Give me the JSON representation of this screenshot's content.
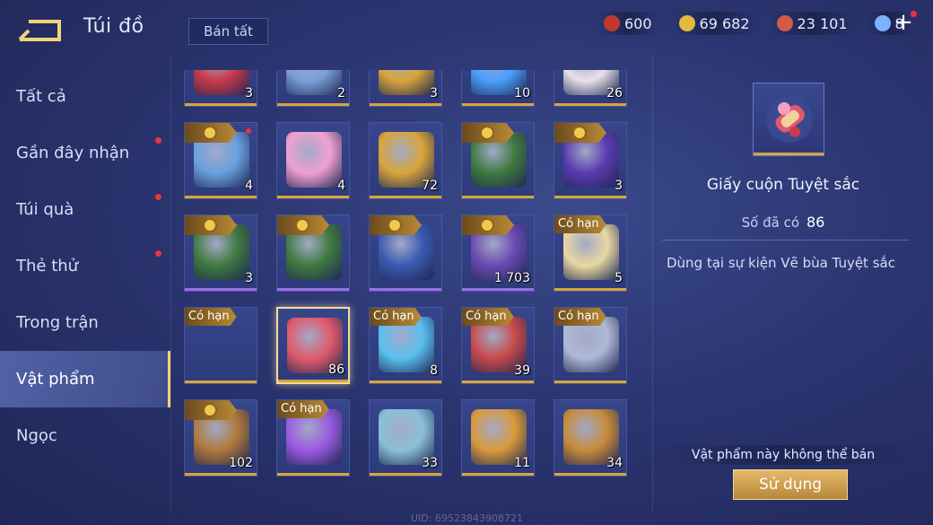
{
  "header": {
    "title": "Túi đồ",
    "sell_all": "Bán tất"
  },
  "currencies": [
    {
      "name": "red-gem-icon",
      "value": "600",
      "color": "#c0392b"
    },
    {
      "name": "gold-coin-icon",
      "value": "69 682",
      "color": "#e5b93b"
    },
    {
      "name": "ruby-icon",
      "value": "23 101",
      "color": "#d35a4a"
    },
    {
      "name": "crystal-card-icon",
      "value": "8",
      "color": "#7ab2ff"
    }
  ],
  "sidebar": {
    "items": [
      {
        "label": "Tất cả",
        "dot": false,
        "active": false
      },
      {
        "label": "Gần đây nhận",
        "dot": true,
        "active": false
      },
      {
        "label": "Túi quà",
        "dot": true,
        "active": false
      },
      {
        "label": "Thẻ thử",
        "dot": true,
        "active": false
      },
      {
        "label": "Trong trận",
        "dot": false,
        "active": false
      },
      {
        "label": "Vật phẩm",
        "dot": false,
        "active": true
      },
      {
        "label": "Ngọc",
        "dot": false,
        "active": false
      }
    ]
  },
  "inventory": {
    "items": [
      {
        "icon": "flower-bouquet-icon",
        "qty": "3",
        "bar": "gold",
        "tag": "",
        "coin": false,
        "dot": false,
        "color": "#c83a4a"
      },
      {
        "icon": "hero-portrait-icon",
        "qty": "2",
        "bar": "gold",
        "tag": "",
        "coin": false,
        "dot": false,
        "color": "#7aa0d8"
      },
      {
        "icon": "gold-shard-icon",
        "qty": "3",
        "bar": "gold",
        "tag": "",
        "coin": false,
        "dot": false,
        "color": "#d9a53a"
      },
      {
        "icon": "blue-crystal-icon",
        "qty": "10",
        "bar": "gold",
        "tag": "",
        "coin": false,
        "dot": false,
        "color": "#4aa0ff"
      },
      {
        "icon": "mask-icon",
        "qty": "26",
        "bar": "gold",
        "tag": "",
        "coin": false,
        "dot": false,
        "color": "#e8e0e8"
      },
      {
        "icon": "birthday-cake-icon",
        "qty": "4",
        "bar": "gold",
        "tag": "",
        "coin": true,
        "dot": true,
        "color": "#6aa0e0"
      },
      {
        "icon": "pink-orb-icon",
        "qty": "4",
        "bar": "gold",
        "tag": "",
        "coin": false,
        "dot": false,
        "color": "#f0a0d0"
      },
      {
        "icon": "golden-hammer-icon",
        "qty": "72",
        "bar": "gold",
        "tag": "",
        "coin": false,
        "dot": false,
        "color": "#d9a53a"
      },
      {
        "icon": "gold-x2-card-icon",
        "qty": "",
        "bar": "gold",
        "tag": "",
        "coin": true,
        "dot": false,
        "color": "#3f7a3f"
      },
      {
        "icon": "purple-banner-icon",
        "qty": "3",
        "bar": "gold",
        "tag": "",
        "coin": true,
        "dot": false,
        "color": "#5a3ab0"
      },
      {
        "icon": "gold-x2-card-icon",
        "qty": "3",
        "bar": "purple",
        "tag": "",
        "coin": true,
        "dot": false,
        "color": "#3f7a3f"
      },
      {
        "icon": "gold-x2-card-icon",
        "qty": "",
        "bar": "purple",
        "tag": "",
        "coin": true,
        "dot": false,
        "color": "#3f7a3f"
      },
      {
        "icon": "exp-x2-card-icon",
        "qty": "",
        "bar": "purple",
        "tag": "",
        "coin": true,
        "dot": false,
        "color": "#3a5ab0"
      },
      {
        "icon": "purple-helmet-icon",
        "qty": "1 703",
        "bar": "purple",
        "tag": "",
        "coin": true,
        "dot": false,
        "color": "#6a4ab0"
      },
      {
        "icon": "fairy-orb-icon",
        "qty": "5",
        "bar": "gold",
        "tag": "Có hạn",
        "coin": false,
        "dot": false,
        "color": "#e8d8a0"
      },
      {
        "icon": "empty-slot-icon",
        "qty": "",
        "bar": "gold",
        "tag": "Có hạn",
        "coin": false,
        "dot": false,
        "color": "transparent"
      },
      {
        "icon": "scroll-icon",
        "qty": "86",
        "bar": "gold",
        "tag": "",
        "coin": false,
        "dot": false,
        "color": "#e05a6a",
        "selected": true
      },
      {
        "icon": "blue-flower-icon",
        "qty": "8",
        "bar": "gold",
        "tag": "Có hạn",
        "coin": false,
        "dot": false,
        "color": "#5ac0f0"
      },
      {
        "icon": "red-bell-icon",
        "qty": "39",
        "bar": "gold",
        "tag": "Có hạn",
        "coin": false,
        "dot": false,
        "color": "#c84a4a"
      },
      {
        "icon": "silver-emblem-icon",
        "qty": "",
        "bar": "gold",
        "tag": "Có hạn",
        "coin": false,
        "dot": false,
        "color": "#b0b8d8"
      },
      {
        "icon": "gold-chest-icon",
        "qty": "102",
        "bar": "gold",
        "tag": "",
        "coin": true,
        "dot": false,
        "color": "#b0783a"
      },
      {
        "icon": "purple-crystal-icon",
        "qty": "",
        "bar": "gold",
        "tag": "Có hạn",
        "coin": false,
        "dot": false,
        "color": "#9a5ae0"
      },
      {
        "icon": "map-scroll-icon",
        "qty": "33",
        "bar": "gold",
        "tag": "",
        "coin": false,
        "dot": false,
        "color": "#8ac0d8"
      },
      {
        "icon": "hero-badge-icon",
        "qty": "11",
        "bar": "gold",
        "tag": "",
        "coin": false,
        "dot": false,
        "color": "#d99a3a"
      },
      {
        "icon": "hero-badge-icon",
        "qty": "34",
        "bar": "gold",
        "tag": "",
        "coin": false,
        "dot": false,
        "color": "#c88a3a"
      }
    ]
  },
  "detail": {
    "icon": "scroll-icon",
    "icon_color": "#e05a6a",
    "name": "Giấy cuộn Tuyệt sắc",
    "owned_label": "Số đã có",
    "owned_value": "86",
    "description": "Dùng tại sự kiện Vẽ bùa Tuyệt sắc",
    "no_sell": "Vật phẩm này không thể bán",
    "use_button": "Sử dụng"
  },
  "uid": "UID: 69523843908721"
}
